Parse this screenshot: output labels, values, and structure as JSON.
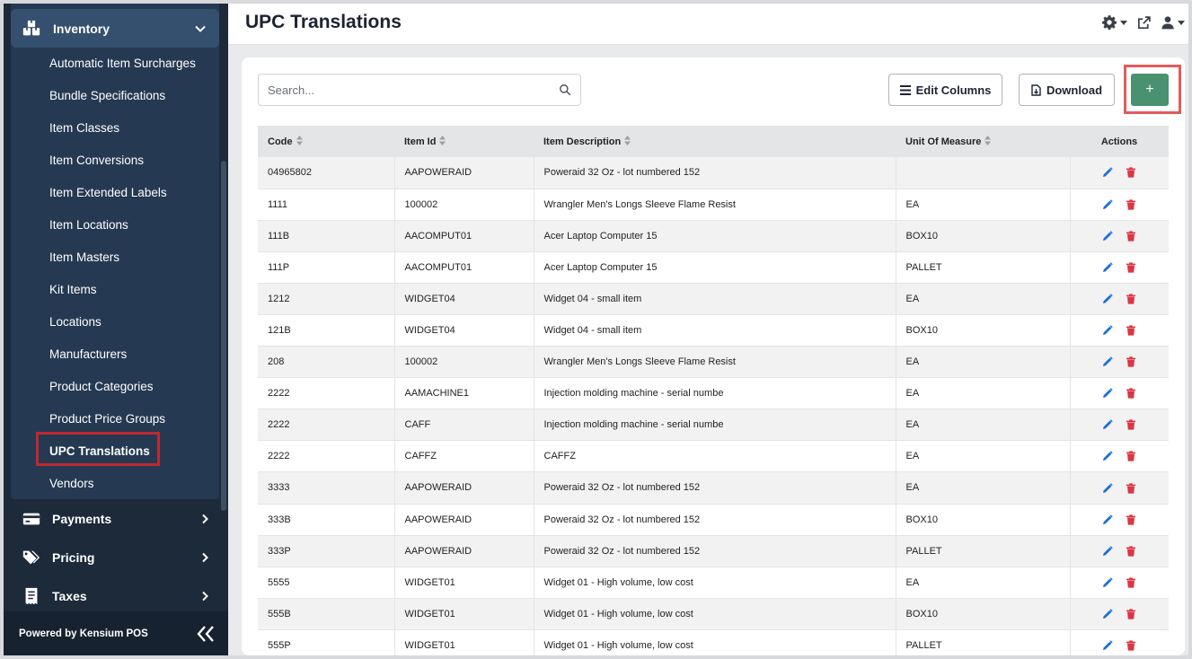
{
  "sidebar": {
    "group_label": "Inventory",
    "items": [
      {
        "label": "Automatic Item Surcharges"
      },
      {
        "label": "Bundle Specifications"
      },
      {
        "label": "Item Classes"
      },
      {
        "label": "Item Conversions"
      },
      {
        "label": "Item Extended Labels"
      },
      {
        "label": "Item Locations"
      },
      {
        "label": "Item Masters"
      },
      {
        "label": "Kit Items"
      },
      {
        "label": "Locations"
      },
      {
        "label": "Manufacturers"
      },
      {
        "label": "Product Categories"
      },
      {
        "label": "Product Price Groups"
      },
      {
        "label": "UPC Translations"
      },
      {
        "label": "Vendors"
      }
    ],
    "groups": [
      {
        "label": "Payments"
      },
      {
        "label": "Pricing"
      },
      {
        "label": "Taxes"
      }
    ],
    "footer": "Powered by Kensium POS"
  },
  "header": {
    "title": "UPC Translations"
  },
  "toolbar": {
    "search_placeholder": "Search...",
    "edit_columns_label": "Edit Columns",
    "download_label": "Download",
    "add_label": "+"
  },
  "table": {
    "columns": [
      "Code",
      "Item Id",
      "Item Description",
      "Unit Of Measure",
      "Actions"
    ],
    "rows": [
      {
        "code": "04965802",
        "item_id": "AAPOWERAID",
        "desc": "Poweraid 32 Oz - lot numbered 152",
        "uom": ""
      },
      {
        "code": "1111",
        "item_id": "100002",
        "desc": "Wrangler Men's Longs Sleeve Flame Resist",
        "uom": "EA"
      },
      {
        "code": "111B",
        "item_id": "AACOMPUT01",
        "desc": "Acer Laptop Computer 15",
        "uom": "BOX10"
      },
      {
        "code": "111P",
        "item_id": "AACOMPUT01",
        "desc": "Acer Laptop Computer 15",
        "uom": "PALLET"
      },
      {
        "code": "1212",
        "item_id": "WIDGET04",
        "desc": "Widget 04 - small item",
        "uom": "EA"
      },
      {
        "code": "121B",
        "item_id": "WIDGET04",
        "desc": "Widget 04 - small item",
        "uom": "BOX10"
      },
      {
        "code": "208",
        "item_id": "100002",
        "desc": "Wrangler Men's Longs Sleeve Flame Resist",
        "uom": "EA"
      },
      {
        "code": "2222",
        "item_id": "AAMACHINE1",
        "desc": "Injection molding machine - serial numbe",
        "uom": "EA"
      },
      {
        "code": "2222",
        "item_id": "CAFF",
        "desc": "Injection molding machine - serial numbe",
        "uom": "EA"
      },
      {
        "code": "2222",
        "item_id": "CAFFZ",
        "desc": "CAFFZ",
        "uom": "EA"
      },
      {
        "code": "3333",
        "item_id": "AAPOWERAID",
        "desc": "Poweraid 32 Oz - lot numbered 152",
        "uom": "EA"
      },
      {
        "code": "333B",
        "item_id": "AAPOWERAID",
        "desc": "Poweraid 32 Oz - lot numbered 152",
        "uom": "BOX10"
      },
      {
        "code": "333P",
        "item_id": "AAPOWERAID",
        "desc": "Poweraid 32 Oz - lot numbered 152",
        "uom": "PALLET"
      },
      {
        "code": "5555",
        "item_id": "WIDGET01",
        "desc": "Widget 01 - High volume, low cost",
        "uom": "EA"
      },
      {
        "code": "555B",
        "item_id": "WIDGET01",
        "desc": "Widget 01 - High volume, low cost",
        "uom": "BOX10"
      },
      {
        "code": "555P",
        "item_id": "WIDGET01",
        "desc": "Widget 01 - High volume, low cost",
        "uom": "PALLET"
      }
    ]
  },
  "colors": {
    "sidebar_bg": "#1c2a3a",
    "accent_green": "#4a9170",
    "highlight_red": "#c0282f",
    "edit_blue": "#1d6fd8",
    "delete_red": "#dc3545"
  }
}
